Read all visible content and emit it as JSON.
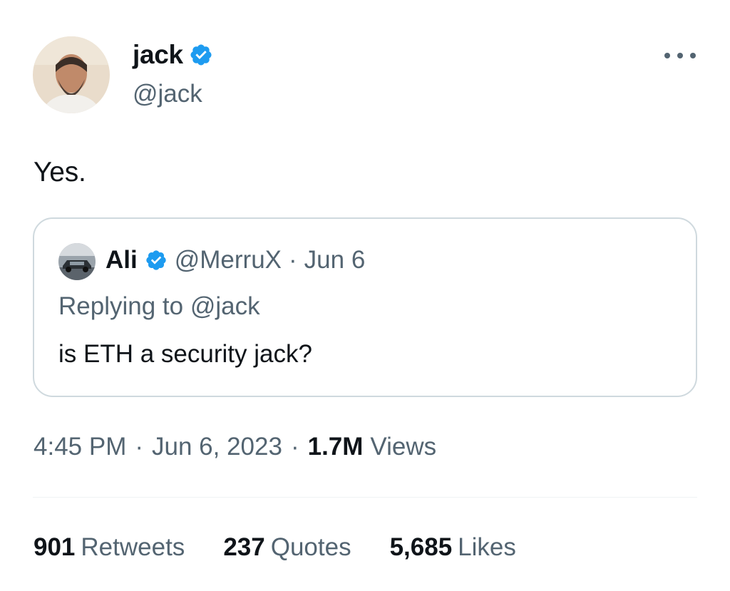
{
  "author": {
    "name": "jack",
    "handle": "@jack",
    "verified": true
  },
  "tweet": {
    "text": "Yes."
  },
  "quoted_tweet": {
    "author_name": "Ali",
    "author_handle": "@MerruX",
    "separator": "·",
    "date": "Jun 6",
    "replying_to_prefix": "Replying to",
    "replying_to_handle": "@jack",
    "text": "is ETH a security jack?"
  },
  "meta": {
    "time": "4:45 PM",
    "separator": "·",
    "date": "Jun 6, 2023",
    "views_count": "1.7M",
    "views_label": "Views"
  },
  "stats": [
    {
      "count": "901",
      "label": "Retweets"
    },
    {
      "count": "237",
      "label": "Quotes"
    },
    {
      "count": "5,685",
      "label": "Likes"
    }
  ],
  "icons": {
    "verified": "verified-badge-icon",
    "more": "more-options-icon"
  },
  "colors": {
    "verified_blue": "#1d9bf0",
    "text_primary": "#0f1419",
    "text_secondary": "#536471",
    "border": "#cfd9de"
  }
}
